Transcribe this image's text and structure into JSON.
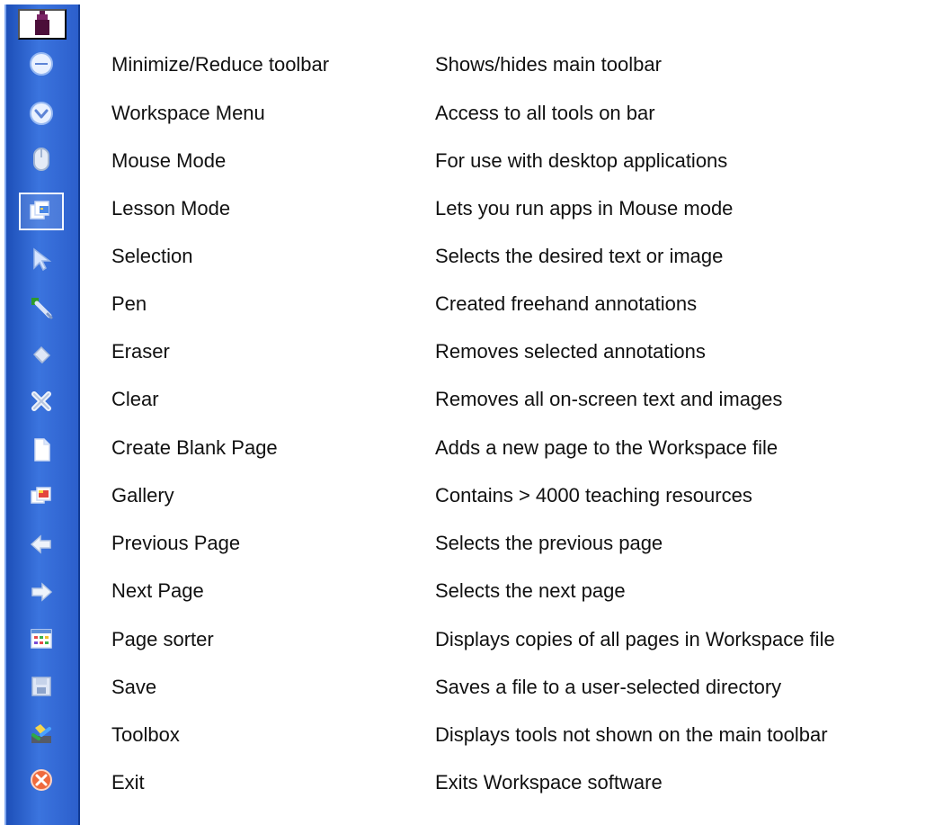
{
  "toolbar": {
    "top_icon": "tool-top-icon",
    "items": [
      {
        "name": "Minimize/Reduce toolbar",
        "description": "Shows/hides main toolbar",
        "icon": "minimize-icon"
      },
      {
        "name": "Workspace Menu",
        "description": "Access to all tools on bar",
        "icon": "workspace-menu-icon"
      },
      {
        "name": "Mouse Mode",
        "description": "For use with desktop applications",
        "icon": "mouse-icon"
      },
      {
        "name": "Lesson Mode",
        "description": "Lets you run apps in Mouse mode",
        "icon": "lesson-mode-icon"
      },
      {
        "name": "Selection",
        "description": "Selects the desired text or image",
        "icon": "selection-arrow-icon"
      },
      {
        "name": "Pen",
        "description": "Created freehand annotations",
        "icon": "pen-icon"
      },
      {
        "name": "Eraser",
        "description": "Removes selected annotations",
        "icon": "eraser-icon"
      },
      {
        "name": "Clear",
        "description": "Removes all on-screen text and images",
        "icon": "clear-icon"
      },
      {
        "name": "Create Blank Page",
        "description": "Adds a new page to the Workspace file",
        "icon": "blank-page-icon"
      },
      {
        "name": "Gallery",
        "description": "Contains > 4000 teaching resources",
        "icon": "gallery-icon"
      },
      {
        "name": "Previous Page",
        "description": "Selects the previous page",
        "icon": "arrow-left-icon"
      },
      {
        "name": "Next Page",
        "description": "Selects the next page",
        "icon": "arrow-right-icon"
      },
      {
        "name": "Page sorter",
        "description": "Displays copies of all pages in Workspace file",
        "icon": "page-sorter-icon"
      },
      {
        "name": "Save",
        "description": "Saves a file to a user-selected directory",
        "icon": "save-icon"
      },
      {
        "name": "Toolbox",
        "description": "Displays tools not shown on the main toolbar",
        "icon": "toolbox-icon"
      },
      {
        "name": "Exit",
        "description": "Exits Workspace software",
        "icon": "exit-icon"
      }
    ]
  },
  "colors": {
    "toolbar_blue": "#2c5fcc",
    "text": "#111111",
    "background": "#ffffff",
    "active_border": "#f3f7ff"
  }
}
